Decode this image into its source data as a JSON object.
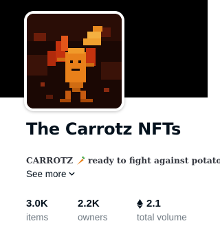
{
  "collection": {
    "title": "The Carrotz NFTs",
    "description_prefix": "CARROTZ",
    "description_suffix": "ready to fight against potatoz",
    "see_more_label": "See more"
  },
  "stats": [
    {
      "value": "3.0K",
      "label": "items"
    },
    {
      "value": "2.2K",
      "label": "owners"
    },
    {
      "value": "2.1",
      "label": "total volume",
      "currency_icon": "ethereum-icon"
    }
  ],
  "icons": {
    "description_emoji": "carrot-icon",
    "see_more": "chevron-down-icon"
  },
  "colors": {
    "banner": "#000000",
    "title": "#04111d",
    "secondary_text": "#707a83",
    "carrot": "#e8801a"
  }
}
